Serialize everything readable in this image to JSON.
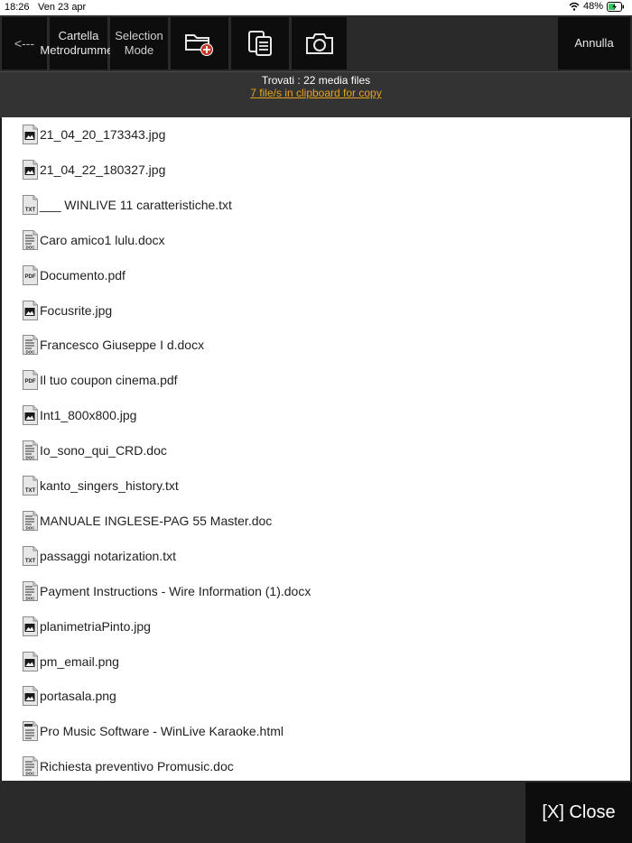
{
  "status": {
    "time": "18:26",
    "date": "Ven 23 apr",
    "battery": "48%"
  },
  "toolbar": {
    "back_label": "<---",
    "folder_label": "Cartella Metrodrummer",
    "selection_label": "Selection Mode",
    "cancel_label": "Annulla"
  },
  "info": {
    "found": "Trovati : 22 media files",
    "clipboard": "7 file/s in clipboard for copy"
  },
  "files": [
    {
      "name": "21_04_20_173343.jpg",
      "type": "img"
    },
    {
      "name": "21_04_22_180327.jpg",
      "type": "img"
    },
    {
      "name": "___ WINLIVE 11 caratteristiche.txt",
      "type": "txt"
    },
    {
      "name": "Caro amico1 lulu.docx",
      "type": "doc"
    },
    {
      "name": "Documento.pdf",
      "type": "pdf"
    },
    {
      "name": "Focusrite.jpg",
      "type": "img"
    },
    {
      "name": "Francesco Giuseppe I d.docx",
      "type": "doc"
    },
    {
      "name": "Il tuo coupon cinema.pdf",
      "type": "pdf"
    },
    {
      "name": "Int1_800x800.jpg",
      "type": "img"
    },
    {
      "name": "Io_sono_qui_CRD.doc",
      "type": "doc"
    },
    {
      "name": "kanto_singers_history.txt",
      "type": "txt"
    },
    {
      "name": "MANUALE INGLESE-PAG 55 Master.doc",
      "type": "doc"
    },
    {
      "name": "passaggi notarization.txt",
      "type": "txt"
    },
    {
      "name": "Payment Instructions - Wire Information (1).docx",
      "type": "doc"
    },
    {
      "name": "planimetriaPinto.jpg",
      "type": "img"
    },
    {
      "name": "pm_email.png",
      "type": "img"
    },
    {
      "name": "portasala.png",
      "type": "img"
    },
    {
      "name": "Pro Music Software - WinLive Karaoke.html",
      "type": "html"
    },
    {
      "name": "Richiesta preventivo Promusic.doc",
      "type": "doc"
    }
  ],
  "close_label": "[X] Close",
  "colors": {
    "accent": "#e8a21e",
    "toolbar_bg": "#2a2a2a",
    "button_bg": "#0d0d0d"
  }
}
